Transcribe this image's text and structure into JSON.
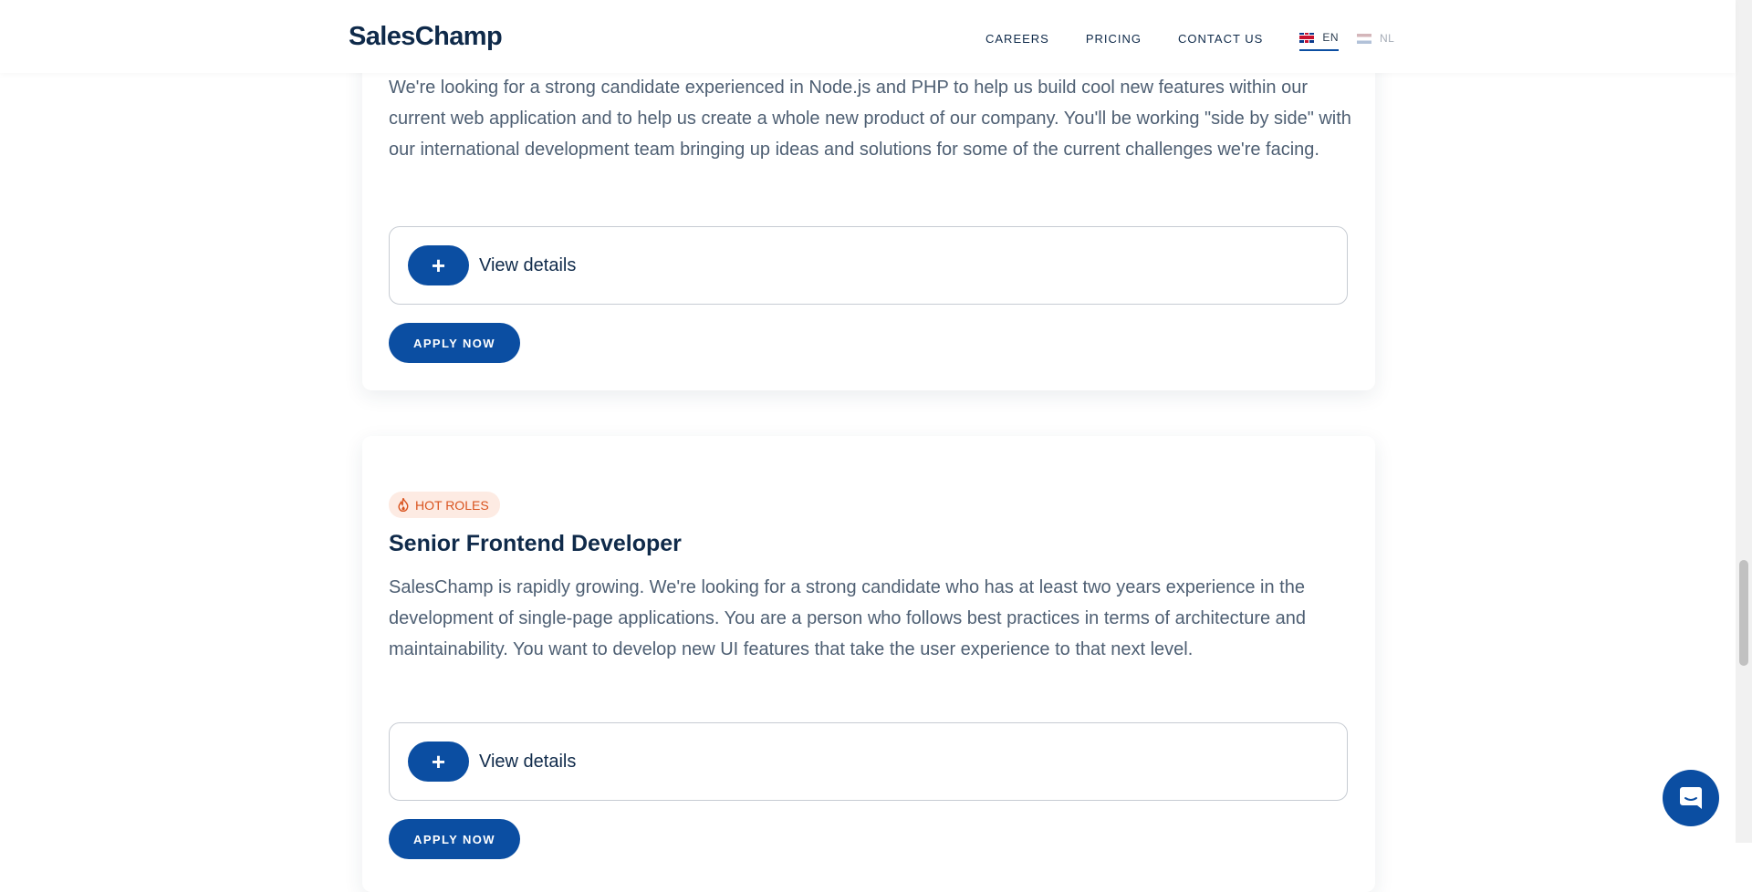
{
  "header": {
    "logo": "SalesChamp",
    "nav": [
      "CAREERS",
      "PRICING",
      "CONTACT US"
    ],
    "languages": [
      {
        "code": "EN",
        "active": true
      },
      {
        "code": "NL",
        "active": false
      }
    ]
  },
  "jobs": [
    {
      "description": "We're looking for a strong candidate experienced in Node.js and PHP to help us build cool new features within our current web application and to help us create a whole new product of our company. You'll be working \"side by side\" with our international development team bringing up ideas and solutions for some of the current challenges we're facing.",
      "details_label": "View details",
      "apply_label": "APPLY NOW"
    },
    {
      "badge": "HOT ROLES",
      "title": "Senior Frontend Developer",
      "description": "SalesChamp is rapidly growing. We're looking for a strong candidate who has at least two years experience in the development of single-page applications. You are a person who follows best practices in terms of architecture and maintainability. You want to develop new UI features that take the user experience to that next level.",
      "details_label": "View details",
      "apply_label": "APPLY NOW"
    }
  ],
  "icons": {
    "plus": "plus-icon",
    "fire": "fire-icon",
    "chat": "chat-icon"
  },
  "colors": {
    "primary": "#0b4ea2",
    "text": "#0f2a4a",
    "body_text": "#4e5f73",
    "badge_bg": "#fdebe3",
    "badge_text": "#d9531e"
  }
}
